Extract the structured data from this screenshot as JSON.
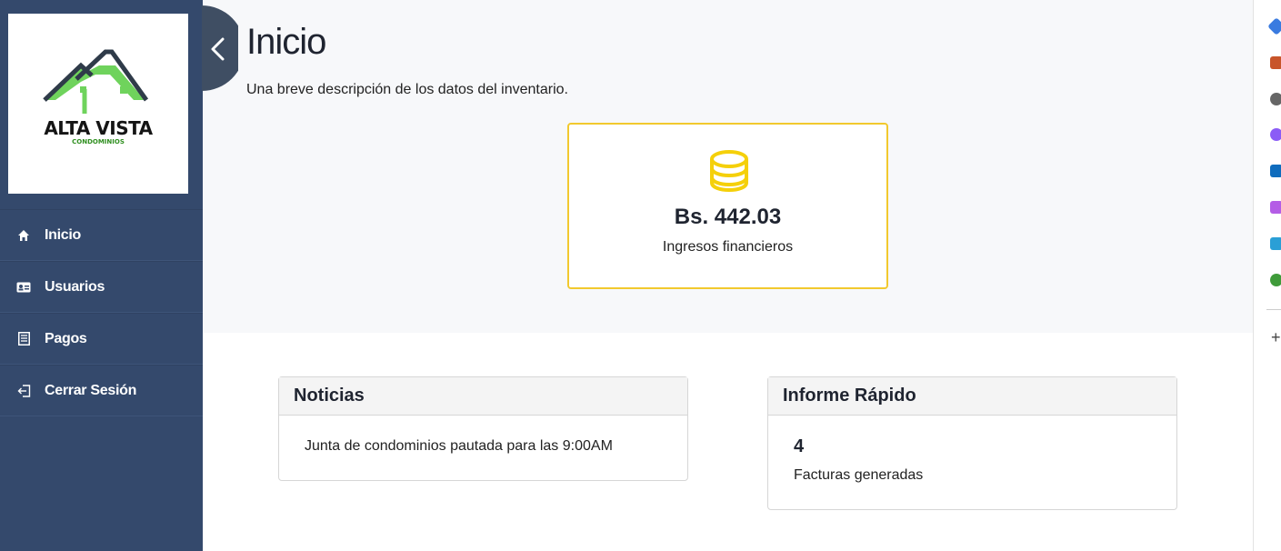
{
  "brand": {
    "name": "ALTA VISTA",
    "tagline": "CONDOMINIOS"
  },
  "nav": [
    {
      "label": "Inicio",
      "icon": "home-icon"
    },
    {
      "label": "Usuarios",
      "icon": "id-card-icon"
    },
    {
      "label": "Pagos",
      "icon": "receipt-icon"
    },
    {
      "label": "Cerrar Sesión",
      "icon": "logout-icon"
    }
  ],
  "page": {
    "title": "Inicio",
    "description": "Una breve descripción de los datos del inventario."
  },
  "stat": {
    "value": "Bs. 442.03",
    "label": "Ingresos financieros",
    "icon": "coins-icon",
    "color": "#f2c92e"
  },
  "news": {
    "title": "Noticias",
    "text": "Junta de condominios pautada para las 9:00AM"
  },
  "report": {
    "title": "Informe Rápido",
    "value": "4",
    "label": "Facturas generadas"
  },
  "colors": {
    "sidebar": "#34496c",
    "toggle": "#3f4e63",
    "accent": "#f2c92e",
    "logo_green": "#6fd35c"
  }
}
